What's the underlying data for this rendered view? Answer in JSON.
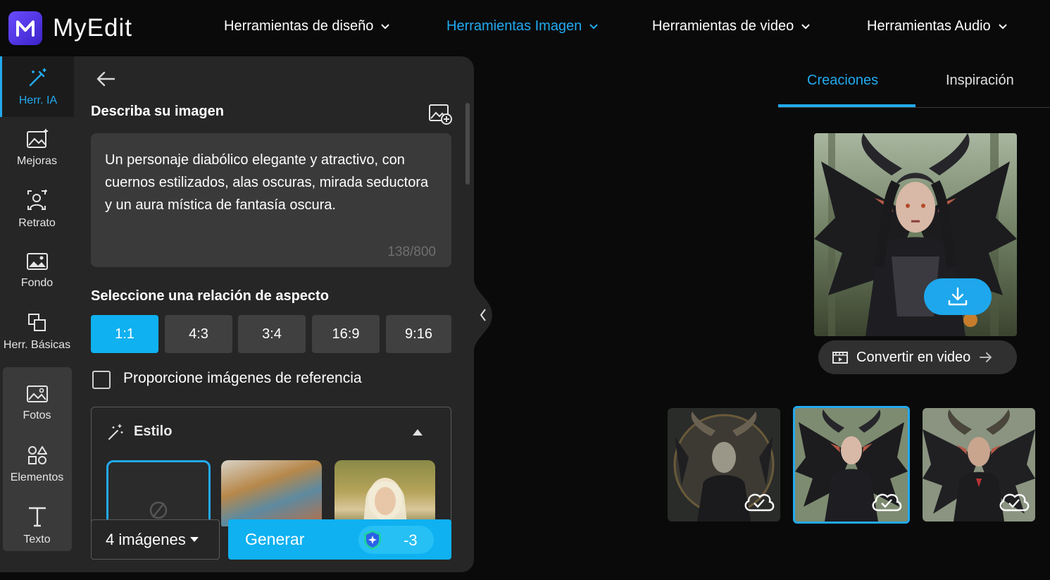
{
  "app": {
    "name": "MyEdit"
  },
  "nav": [
    {
      "label": "Herramientas de diseño",
      "active": false
    },
    {
      "label": "Herramientas Imagen",
      "active": true
    },
    {
      "label": "Herramientas de video",
      "active": false
    },
    {
      "label": "Herramientas Audio",
      "active": false
    }
  ],
  "sidebar": {
    "items": [
      {
        "label": "Herr. IA",
        "icon": "magic-wand-icon",
        "active": true
      },
      {
        "label": "Mejoras",
        "icon": "image-enhance-icon"
      },
      {
        "label": "Retrato",
        "icon": "portrait-icon"
      },
      {
        "label": "Fondo",
        "icon": "background-icon"
      },
      {
        "label": "Herr. Básicas",
        "icon": "crop-icon"
      },
      {
        "label": "Fotos",
        "icon": "photos-icon"
      },
      {
        "label": "Elementos",
        "icon": "shapes-icon"
      },
      {
        "label": "Texto",
        "icon": "text-icon"
      }
    ]
  },
  "panel": {
    "describe_title": "Describa su imagen",
    "prompt_text": "Un personaje diabólico elegante y atractivo, con cuernos estilizados, alas oscuras, mirada seductora y un aura mística de fantasía oscura.",
    "char_count": "138/800",
    "aspect_title": "Seleccione una relación de aspecto",
    "aspect_ratios": [
      "1:1",
      "4:3",
      "3:4",
      "16:9",
      "9:16"
    ],
    "aspect_selected": "1:1",
    "reference_label": "Proporcione imágenes de referencia",
    "reference_checked": false,
    "style_title": "Estilo",
    "count_label": "4 imágenes",
    "generate_label": "Generar",
    "credit_cost": "-3"
  },
  "results": {
    "tabs": [
      {
        "label": "Creaciones",
        "active": true
      },
      {
        "label": "Inspiración",
        "active": false
      }
    ],
    "convert_label": "Convertir en video",
    "thumbnails_count": 3,
    "selected_thumbnail": 2
  },
  "colors": {
    "accent": "#22aaf0",
    "button": "#0fb1f0",
    "panel": "#262626",
    "background": "#0a0a0a"
  }
}
